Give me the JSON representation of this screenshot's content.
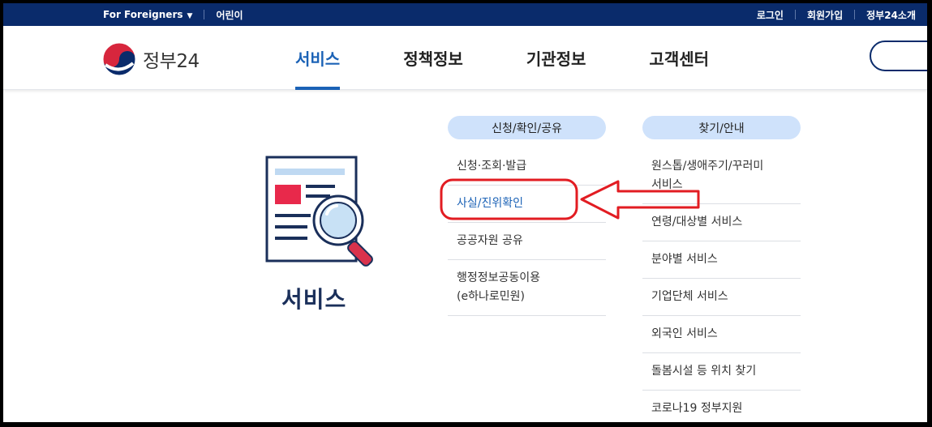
{
  "utility": {
    "left": [
      "For Foreigners",
      "어린이"
    ],
    "right": [
      "로그인",
      "회원가입",
      "정부24소개"
    ]
  },
  "header": {
    "logo_text": "정부24",
    "nav": [
      "서비스",
      "정책정보",
      "기관정보",
      "고객센터"
    ]
  },
  "hero": {
    "title": "서비스"
  },
  "columns": [
    {
      "heading": "신청/확인/공유",
      "items": [
        "신청·조회·발급",
        "사실/진위확인",
        "공공자원 공유",
        "행정정보공동이용\n(e하나로민원)"
      ]
    },
    {
      "heading": "찾기/안내",
      "items": [
        "원스톱/생애주기/꾸러미 서비스",
        "연령/대상별 서비스",
        "분야별 서비스",
        "기업단체 서비스",
        "외국인 서비스",
        "돌봄시설 등 위치 찾기",
        "코로나19 정부지원"
      ]
    }
  ],
  "colors": {
    "navy": "#0a2b6b",
    "accent": "#1b62b6",
    "pill": "#cfe2fb",
    "annotation": "#e21c22"
  },
  "icons": {
    "caret": "caret-down-icon",
    "logo": "taegeuk-logo-icon",
    "hero": "document-magnifier-icon",
    "arrow": "left-arrow-annotation"
  }
}
